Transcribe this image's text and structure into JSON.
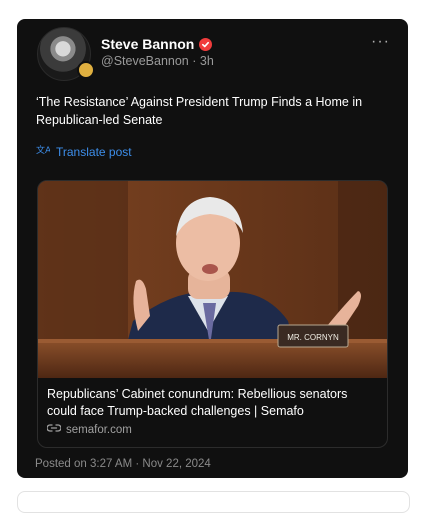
{
  "post": {
    "author_name": "Steve Bannon",
    "handle": "@SteveBannon",
    "separator": "·",
    "age": "3h",
    "more_label": "···",
    "text": "‘The Resistance’ Against President Trump Finds a Home in Republican-led Senate",
    "translate_label": "Translate post",
    "link_card": {
      "title": "Republicans’ Cabinet conundrum: Rebellious senators could face Trump-backed challenges | Semafo",
      "domain": "semafor.com",
      "image_nameplate": "MR. CORNYN"
    },
    "timestamp": "Posted on 3:27 AM · Nov 22, 2024"
  },
  "colors": {
    "card_bg": "#101010",
    "link_blue": "#3d8eea",
    "verified_red": "#f03c3c",
    "muted_text": "#9a9a9a"
  },
  "icons": {
    "verified": "verified-check-icon",
    "translate": "translate-icon",
    "link": "link-icon",
    "more": "more-options-icon"
  }
}
